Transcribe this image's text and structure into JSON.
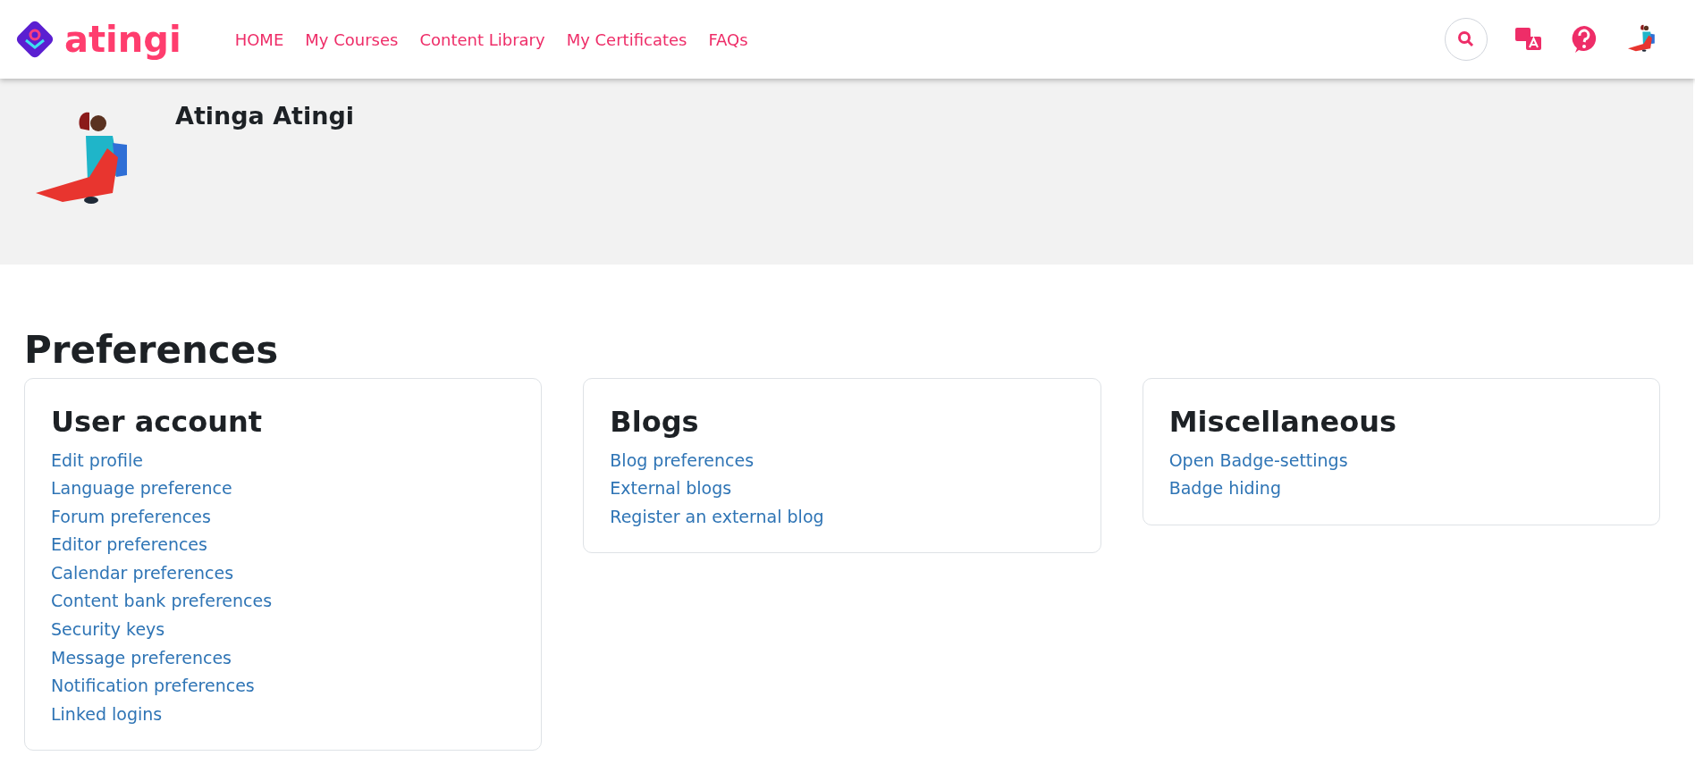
{
  "brand": {
    "name": "atingi"
  },
  "nav": [
    {
      "label": "HOME"
    },
    {
      "label": "My Courses"
    },
    {
      "label": "Content Library"
    },
    {
      "label": "My Certificates"
    },
    {
      "label": "FAQs"
    }
  ],
  "profile": {
    "name": "Atinga Atingi"
  },
  "page_title": "Preferences",
  "cards": [
    {
      "title": "User account",
      "links": [
        "Edit profile",
        "Language preference",
        "Forum preferences",
        "Editor preferences",
        "Calendar preferences",
        "Content bank preferences",
        "Security keys",
        "Message preferences",
        "Notification preferences",
        "Linked logins"
      ]
    },
    {
      "title": "Blogs",
      "links": [
        "Blog preferences",
        "External blogs",
        "Register an external blog"
      ]
    },
    {
      "title": "Miscellaneous",
      "links": [
        "Open Badge-settings",
        "Badge hiding"
      ]
    }
  ]
}
